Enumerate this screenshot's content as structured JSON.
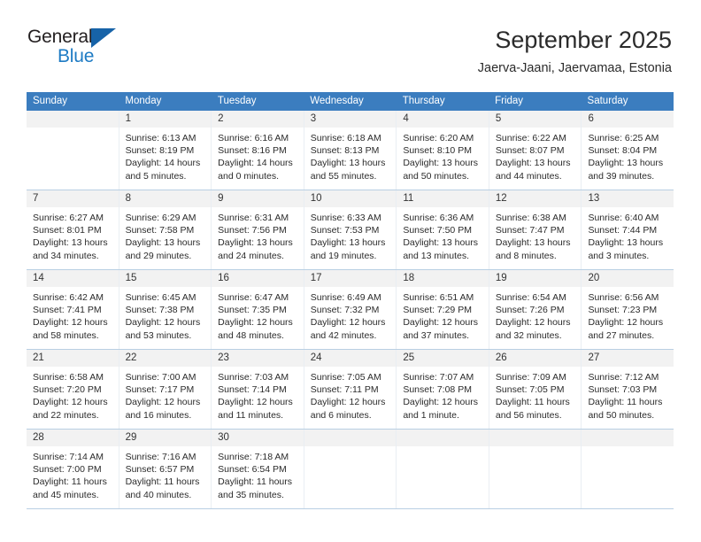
{
  "brand": {
    "name_part1": "General",
    "name_part2": "Blue",
    "logo_icon": "triangle-flag-icon",
    "color_dark": "#231f20",
    "color_blue": "#1e7bc4",
    "triangle_color": "#1763a8"
  },
  "header": {
    "month_title": "September 2025",
    "location": "Jaerva-Jaani, Jaervamaa, Estonia"
  },
  "calendar": {
    "header_bg": "#3b7dbf",
    "daynum_bg": "#f2f2f2",
    "weekdays": [
      "Sunday",
      "Monday",
      "Tuesday",
      "Wednesday",
      "Thursday",
      "Friday",
      "Saturday"
    ],
    "weeks": [
      [
        {
          "day": "",
          "sunrise": "",
          "sunset": "",
          "daylight1": "",
          "daylight2": ""
        },
        {
          "day": "1",
          "sunrise": "Sunrise: 6:13 AM",
          "sunset": "Sunset: 8:19 PM",
          "daylight1": "Daylight: 14 hours",
          "daylight2": "and 5 minutes."
        },
        {
          "day": "2",
          "sunrise": "Sunrise: 6:16 AM",
          "sunset": "Sunset: 8:16 PM",
          "daylight1": "Daylight: 14 hours",
          "daylight2": "and 0 minutes."
        },
        {
          "day": "3",
          "sunrise": "Sunrise: 6:18 AM",
          "sunset": "Sunset: 8:13 PM",
          "daylight1": "Daylight: 13 hours",
          "daylight2": "and 55 minutes."
        },
        {
          "day": "4",
          "sunrise": "Sunrise: 6:20 AM",
          "sunset": "Sunset: 8:10 PM",
          "daylight1": "Daylight: 13 hours",
          "daylight2": "and 50 minutes."
        },
        {
          "day": "5",
          "sunrise": "Sunrise: 6:22 AM",
          "sunset": "Sunset: 8:07 PM",
          "daylight1": "Daylight: 13 hours",
          "daylight2": "and 44 minutes."
        },
        {
          "day": "6",
          "sunrise": "Sunrise: 6:25 AM",
          "sunset": "Sunset: 8:04 PM",
          "daylight1": "Daylight: 13 hours",
          "daylight2": "and 39 minutes."
        }
      ],
      [
        {
          "day": "7",
          "sunrise": "Sunrise: 6:27 AM",
          "sunset": "Sunset: 8:01 PM",
          "daylight1": "Daylight: 13 hours",
          "daylight2": "and 34 minutes."
        },
        {
          "day": "8",
          "sunrise": "Sunrise: 6:29 AM",
          "sunset": "Sunset: 7:58 PM",
          "daylight1": "Daylight: 13 hours",
          "daylight2": "and 29 minutes."
        },
        {
          "day": "9",
          "sunrise": "Sunrise: 6:31 AM",
          "sunset": "Sunset: 7:56 PM",
          "daylight1": "Daylight: 13 hours",
          "daylight2": "and 24 minutes."
        },
        {
          "day": "10",
          "sunrise": "Sunrise: 6:33 AM",
          "sunset": "Sunset: 7:53 PM",
          "daylight1": "Daylight: 13 hours",
          "daylight2": "and 19 minutes."
        },
        {
          "day": "11",
          "sunrise": "Sunrise: 6:36 AM",
          "sunset": "Sunset: 7:50 PM",
          "daylight1": "Daylight: 13 hours",
          "daylight2": "and 13 minutes."
        },
        {
          "day": "12",
          "sunrise": "Sunrise: 6:38 AM",
          "sunset": "Sunset: 7:47 PM",
          "daylight1": "Daylight: 13 hours",
          "daylight2": "and 8 minutes."
        },
        {
          "day": "13",
          "sunrise": "Sunrise: 6:40 AM",
          "sunset": "Sunset: 7:44 PM",
          "daylight1": "Daylight: 13 hours",
          "daylight2": "and 3 minutes."
        }
      ],
      [
        {
          "day": "14",
          "sunrise": "Sunrise: 6:42 AM",
          "sunset": "Sunset: 7:41 PM",
          "daylight1": "Daylight: 12 hours",
          "daylight2": "and 58 minutes."
        },
        {
          "day": "15",
          "sunrise": "Sunrise: 6:45 AM",
          "sunset": "Sunset: 7:38 PM",
          "daylight1": "Daylight: 12 hours",
          "daylight2": "and 53 minutes."
        },
        {
          "day": "16",
          "sunrise": "Sunrise: 6:47 AM",
          "sunset": "Sunset: 7:35 PM",
          "daylight1": "Daylight: 12 hours",
          "daylight2": "and 48 minutes."
        },
        {
          "day": "17",
          "sunrise": "Sunrise: 6:49 AM",
          "sunset": "Sunset: 7:32 PM",
          "daylight1": "Daylight: 12 hours",
          "daylight2": "and 42 minutes."
        },
        {
          "day": "18",
          "sunrise": "Sunrise: 6:51 AM",
          "sunset": "Sunset: 7:29 PM",
          "daylight1": "Daylight: 12 hours",
          "daylight2": "and 37 minutes."
        },
        {
          "day": "19",
          "sunrise": "Sunrise: 6:54 AM",
          "sunset": "Sunset: 7:26 PM",
          "daylight1": "Daylight: 12 hours",
          "daylight2": "and 32 minutes."
        },
        {
          "day": "20",
          "sunrise": "Sunrise: 6:56 AM",
          "sunset": "Sunset: 7:23 PM",
          "daylight1": "Daylight: 12 hours",
          "daylight2": "and 27 minutes."
        }
      ],
      [
        {
          "day": "21",
          "sunrise": "Sunrise: 6:58 AM",
          "sunset": "Sunset: 7:20 PM",
          "daylight1": "Daylight: 12 hours",
          "daylight2": "and 22 minutes."
        },
        {
          "day": "22",
          "sunrise": "Sunrise: 7:00 AM",
          "sunset": "Sunset: 7:17 PM",
          "daylight1": "Daylight: 12 hours",
          "daylight2": "and 16 minutes."
        },
        {
          "day": "23",
          "sunrise": "Sunrise: 7:03 AM",
          "sunset": "Sunset: 7:14 PM",
          "daylight1": "Daylight: 12 hours",
          "daylight2": "and 11 minutes."
        },
        {
          "day": "24",
          "sunrise": "Sunrise: 7:05 AM",
          "sunset": "Sunset: 7:11 PM",
          "daylight1": "Daylight: 12 hours",
          "daylight2": "and 6 minutes."
        },
        {
          "day": "25",
          "sunrise": "Sunrise: 7:07 AM",
          "sunset": "Sunset: 7:08 PM",
          "daylight1": "Daylight: 12 hours",
          "daylight2": "and 1 minute."
        },
        {
          "day": "26",
          "sunrise": "Sunrise: 7:09 AM",
          "sunset": "Sunset: 7:05 PM",
          "daylight1": "Daylight: 11 hours",
          "daylight2": "and 56 minutes."
        },
        {
          "day": "27",
          "sunrise": "Sunrise: 7:12 AM",
          "sunset": "Sunset: 7:03 PM",
          "daylight1": "Daylight: 11 hours",
          "daylight2": "and 50 minutes."
        }
      ],
      [
        {
          "day": "28",
          "sunrise": "Sunrise: 7:14 AM",
          "sunset": "Sunset: 7:00 PM",
          "daylight1": "Daylight: 11 hours",
          "daylight2": "and 45 minutes."
        },
        {
          "day": "29",
          "sunrise": "Sunrise: 7:16 AM",
          "sunset": "Sunset: 6:57 PM",
          "daylight1": "Daylight: 11 hours",
          "daylight2": "and 40 minutes."
        },
        {
          "day": "30",
          "sunrise": "Sunrise: 7:18 AM",
          "sunset": "Sunset: 6:54 PM",
          "daylight1": "Daylight: 11 hours",
          "daylight2": "and 35 minutes."
        },
        {
          "day": "",
          "sunrise": "",
          "sunset": "",
          "daylight1": "",
          "daylight2": ""
        },
        {
          "day": "",
          "sunrise": "",
          "sunset": "",
          "daylight1": "",
          "daylight2": ""
        },
        {
          "day": "",
          "sunrise": "",
          "sunset": "",
          "daylight1": "",
          "daylight2": ""
        },
        {
          "day": "",
          "sunrise": "",
          "sunset": "",
          "daylight1": "",
          "daylight2": ""
        }
      ]
    ]
  }
}
